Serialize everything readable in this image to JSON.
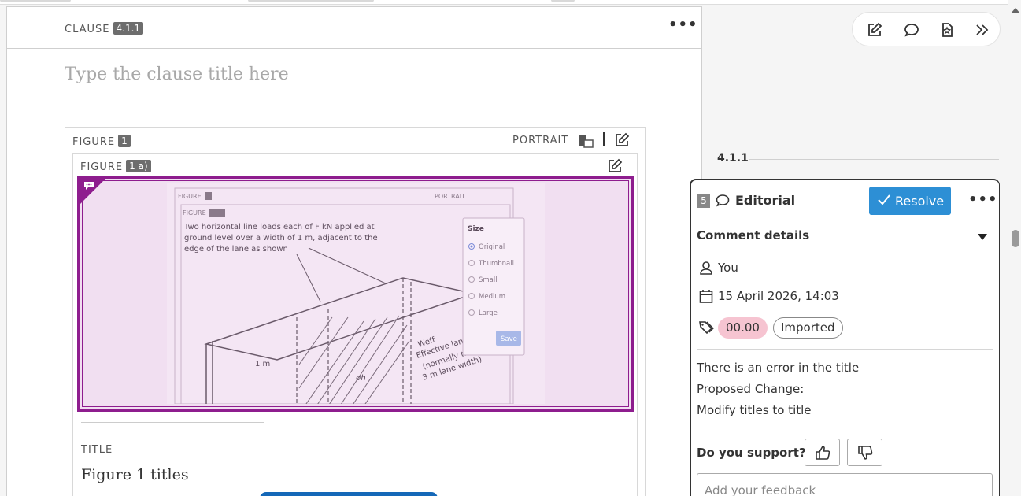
{
  "clause": {
    "label": "CLAUSE",
    "number": "4.1.1",
    "title_placeholder": "Type the clause title here"
  },
  "figure": {
    "label": "FIGURE",
    "number": "1",
    "orientation": "PORTRAIT",
    "sub_label": "FIGURE",
    "sub_number": "1 a)",
    "title_label": "TITLE",
    "title_value": "Figure 1 titles"
  },
  "embedded_image": {
    "caption_text": "Two horizontal line loads each of F kN applied at ground level over a width of 1 m, adjacent to the edge of the lane as shown",
    "size_menu_title": "Size",
    "size_options": [
      "Original",
      "Thumbnail",
      "Small",
      "Medium",
      "Large"
    ],
    "save_label": "Save"
  },
  "right_panel": {
    "anchor": "4.1.1"
  },
  "comment": {
    "index": "5",
    "type": "Editorial",
    "resolve_label": "Resolve",
    "details_title": "Comment details",
    "author": "You",
    "date": "15 April 2026, 14:03",
    "tags": [
      "00.00",
      "Imported"
    ],
    "lines": [
      "There is an error in the title",
      "Proposed Change:",
      "Modify titles to title"
    ],
    "support_label": "Do you support?",
    "feedback_placeholder": "Add your feedback"
  },
  "colors": {
    "highlight": "#8e1d8e",
    "highlight_fill": "#f1dff1",
    "resolve": "#2d8fd5",
    "tag_red": "#f6c4d1"
  }
}
